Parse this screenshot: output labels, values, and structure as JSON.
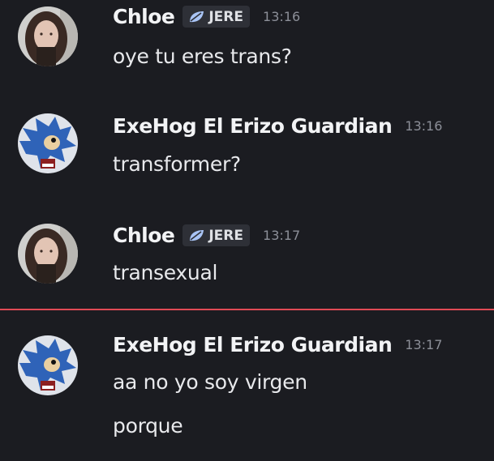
{
  "messages": [
    {
      "author": "Chloe",
      "tag": "JERE",
      "time": "13:16",
      "lines": [
        "oye tu eres trans?"
      ]
    },
    {
      "author": "ExeHog El Erizo Guardian",
      "time": "13:16",
      "lines": [
        "transformer?"
      ]
    },
    {
      "author": "Chloe",
      "tag": "JERE",
      "time": "13:17",
      "lines": [
        "transexual"
      ]
    },
    {
      "author": "ExeHog El Erizo Guardian",
      "time": "13:17",
      "lines": [
        "aa no yo soy virgen",
        "porque"
      ]
    }
  ],
  "colors": {
    "background": "#1b1c21",
    "new_messages_divider": "#e04a55",
    "timestamp": "#8c8f98"
  },
  "icons": {
    "tag_icon": "leaf-icon"
  }
}
